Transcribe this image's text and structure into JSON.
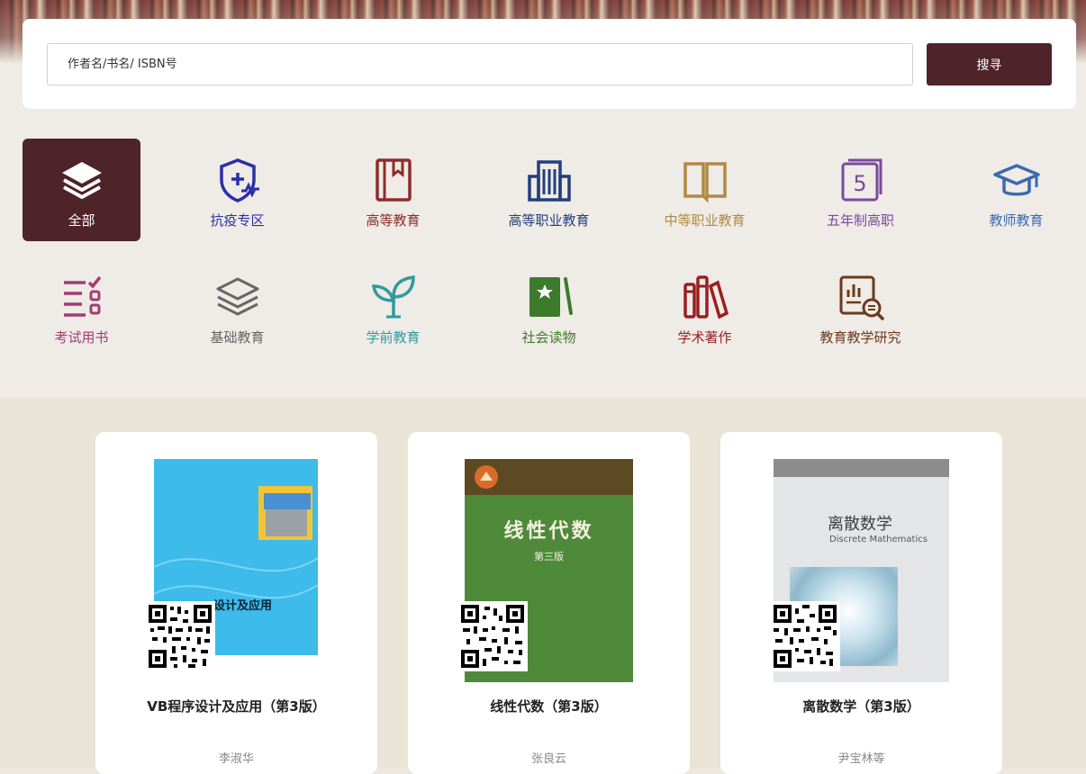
{
  "search": {
    "placeholder": "作者名/书名/ ISBN号",
    "button_label": "搜寻"
  },
  "categories": [
    {
      "label": "全部",
      "icon": "layers-icon",
      "color": "#ffffff",
      "active": true
    },
    {
      "label": "抗疫专区",
      "icon": "medical-shield-icon",
      "color": "#2a2fa6"
    },
    {
      "label": "高等教育",
      "icon": "bookmark-book-icon",
      "color": "#8e2d2a"
    },
    {
      "label": "高等职业教育",
      "icon": "building-icon",
      "color": "#23407d"
    },
    {
      "label": "中等职业教育",
      "icon": "open-book-icon",
      "color": "#b08a45"
    },
    {
      "label": "五年制高职",
      "icon": "calendar-five-icon",
      "color": "#7a4a9e"
    },
    {
      "label": "教师教育",
      "icon": "graduation-cap-icon",
      "color": "#3a6ab0"
    },
    {
      "label": "考试用书",
      "icon": "checklist-icon",
      "color": "#a23c72"
    },
    {
      "label": "基础教育",
      "icon": "stack-icon",
      "color": "#666666"
    },
    {
      "label": "学前教育",
      "icon": "sprout-icon",
      "color": "#2f9aa0"
    },
    {
      "label": "社会读物",
      "icon": "star-book-icon",
      "color": "#3e7a2c"
    },
    {
      "label": "学术著作",
      "icon": "books-shelf-icon",
      "color": "#9a1f22"
    },
    {
      "label": "教育教学研究",
      "icon": "research-magnifier-icon",
      "color": "#6b3a1c"
    }
  ],
  "books": [
    {
      "title": "VB程序设计及应用（第3版）",
      "author": "李淑华",
      "cover_text": "设计及应用",
      "cover_color": "#3dbbea"
    },
    {
      "title": "线性代数（第3版）",
      "author": "张良云",
      "cover_text": "线性代数",
      "cover_subtitle": "第三版",
      "cover_color": "#4f8a3a"
    },
    {
      "title": "离散数学（第3版）",
      "author": "尹宝林等",
      "cover_text": "离散数学",
      "cover_en": "Discrete Mathematics",
      "cover_color": "#d9dcdf"
    }
  ]
}
